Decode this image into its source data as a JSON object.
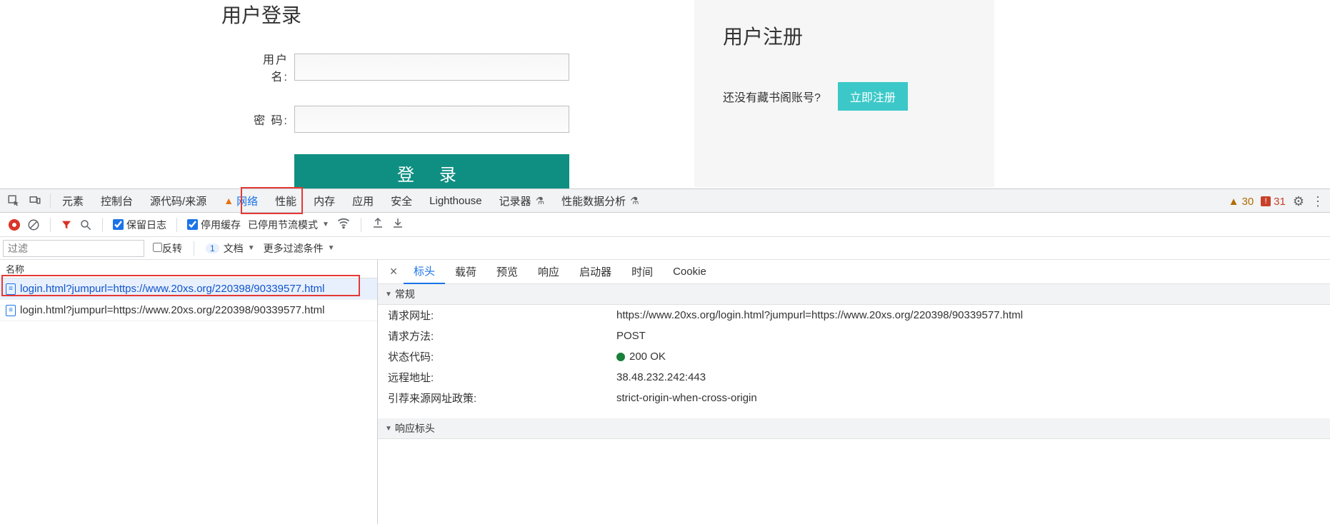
{
  "page": {
    "login_title": "用户登录",
    "username_label": "用户名:",
    "password_label": "密  码:",
    "login_btn": "登 录",
    "register_title": "用户注册",
    "register_question": "还没有藏书阁账号?",
    "register_btn": "立即注册"
  },
  "devtools": {
    "tabs": {
      "elements": "元素",
      "console": "控制台",
      "sources": "源代码/来源",
      "network": "网络",
      "performance": "性能",
      "memory": "内存",
      "application": "应用",
      "security": "安全",
      "lighthouse": "Lighthouse",
      "recorder": "记录器",
      "perf_insights": "性能数据分析"
    },
    "warn_count": "30",
    "error_count": "31"
  },
  "network_toolbar": {
    "preserve_log": "保留日志",
    "disable_cache": "停用缓存",
    "throttling": "已停用节流模式"
  },
  "network_filter": {
    "placeholder": "过滤",
    "invert": "反转",
    "doc_count": "1",
    "doc_label": "文档",
    "more": "更多过滤条件"
  },
  "request_list": {
    "header": "名称",
    "items": [
      "login.html?jumpurl=https://www.20xs.org/220398/90339577.html",
      "login.html?jumpurl=https://www.20xs.org/220398/90339577.html"
    ]
  },
  "detail": {
    "tabs": {
      "headers": "标头",
      "payload": "载荷",
      "preview": "预览",
      "response": "响应",
      "initiator": "启动器",
      "timing": "时间",
      "cookies": "Cookie"
    },
    "general_title": "常规",
    "general": {
      "request_url_k": "请求网址:",
      "request_url_v": "https://www.20xs.org/login.html?jumpurl=https://www.20xs.org/220398/90339577.html",
      "method_k": "请求方法:",
      "method_v": "POST",
      "status_k": "状态代码:",
      "status_v": "200 OK",
      "remote_k": "远程地址:",
      "remote_v": "38.48.232.242:443",
      "referrer_k": "引荐来源网址政策:",
      "referrer_v": "strict-origin-when-cross-origin"
    },
    "response_headers_title": "响应标头"
  }
}
